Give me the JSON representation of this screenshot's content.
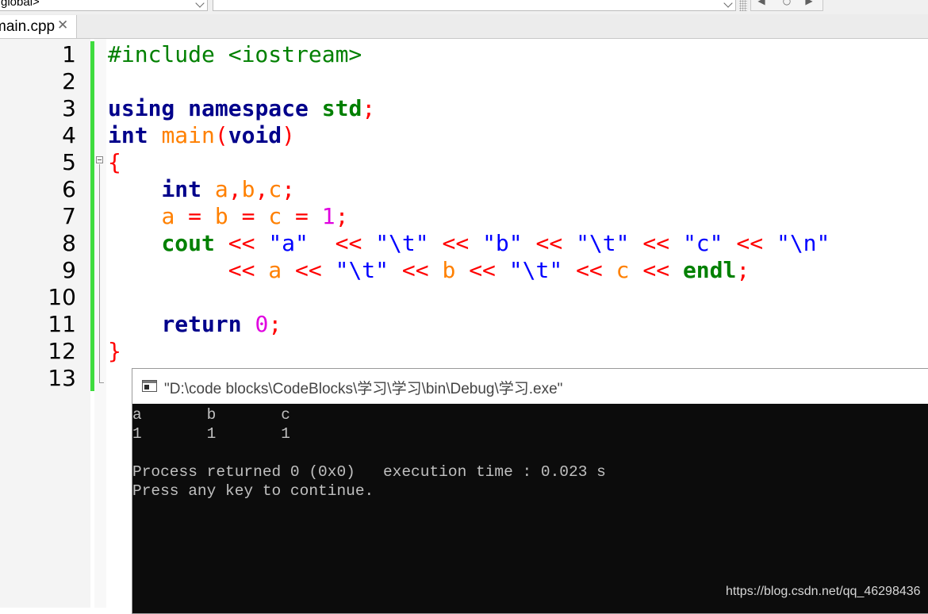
{
  "toolbar": {
    "scope_combo": "global>",
    "symbol_combo": "",
    "buttons": [
      "bookmark-prev-icon",
      "stop-icon",
      "bookmark-next-icon"
    ]
  },
  "tabs": [
    {
      "label": "main.cpp",
      "close_icon": "close-icon"
    }
  ],
  "editor": {
    "line_numbers": [
      "1",
      "2",
      "3",
      "4",
      "5",
      "6",
      "7",
      "8",
      "9",
      "10",
      "11",
      "12",
      "13"
    ],
    "lines": [
      [
        {
          "t": "#include <iostream>",
          "c": "pre"
        }
      ],
      [],
      [
        {
          "t": "using",
          "c": "kw"
        },
        {
          "t": " ",
          "c": "plain"
        },
        {
          "t": "namespace",
          "c": "kw"
        },
        {
          "t": " ",
          "c": "plain"
        },
        {
          "t": "std",
          "c": "kwg"
        },
        {
          "t": ";",
          "c": "op"
        }
      ],
      [
        {
          "t": "int",
          "c": "kw"
        },
        {
          "t": " ",
          "c": "plain"
        },
        {
          "t": "main",
          "c": "id"
        },
        {
          "t": "(",
          "c": "op"
        },
        {
          "t": "void",
          "c": "kw"
        },
        {
          "t": ")",
          "c": "op"
        }
      ],
      [
        {
          "t": "{",
          "c": "op"
        }
      ],
      [
        {
          "t": "    ",
          "c": "plain"
        },
        {
          "t": "int",
          "c": "kw"
        },
        {
          "t": " ",
          "c": "plain"
        },
        {
          "t": "a",
          "c": "id"
        },
        {
          "t": ",",
          "c": "op"
        },
        {
          "t": "b",
          "c": "id"
        },
        {
          "t": ",",
          "c": "op"
        },
        {
          "t": "c",
          "c": "id"
        },
        {
          "t": ";",
          "c": "op"
        }
      ],
      [
        {
          "t": "    ",
          "c": "plain"
        },
        {
          "t": "a",
          "c": "id"
        },
        {
          "t": " ",
          "c": "plain"
        },
        {
          "t": "=",
          "c": "op"
        },
        {
          "t": " ",
          "c": "plain"
        },
        {
          "t": "b",
          "c": "id"
        },
        {
          "t": " ",
          "c": "plain"
        },
        {
          "t": "=",
          "c": "op"
        },
        {
          "t": " ",
          "c": "plain"
        },
        {
          "t": "c",
          "c": "id"
        },
        {
          "t": " ",
          "c": "plain"
        },
        {
          "t": "=",
          "c": "op"
        },
        {
          "t": " ",
          "c": "plain"
        },
        {
          "t": "1",
          "c": "num"
        },
        {
          "t": ";",
          "c": "op"
        }
      ],
      [
        {
          "t": "    ",
          "c": "plain"
        },
        {
          "t": "cout",
          "c": "kwg"
        },
        {
          "t": " ",
          "c": "plain"
        },
        {
          "t": "<<",
          "c": "op"
        },
        {
          "t": " ",
          "c": "plain"
        },
        {
          "t": "\"a\"",
          "c": "str"
        },
        {
          "t": "  ",
          "c": "plain"
        },
        {
          "t": "<<",
          "c": "op"
        },
        {
          "t": " ",
          "c": "plain"
        },
        {
          "t": "\"\\t\"",
          "c": "str"
        },
        {
          "t": " ",
          "c": "plain"
        },
        {
          "t": "<<",
          "c": "op"
        },
        {
          "t": " ",
          "c": "plain"
        },
        {
          "t": "\"b\"",
          "c": "str"
        },
        {
          "t": " ",
          "c": "plain"
        },
        {
          "t": "<<",
          "c": "op"
        },
        {
          "t": " ",
          "c": "plain"
        },
        {
          "t": "\"\\t\"",
          "c": "str"
        },
        {
          "t": " ",
          "c": "plain"
        },
        {
          "t": "<<",
          "c": "op"
        },
        {
          "t": " ",
          "c": "plain"
        },
        {
          "t": "\"c\"",
          "c": "str"
        },
        {
          "t": " ",
          "c": "plain"
        },
        {
          "t": "<<",
          "c": "op"
        },
        {
          "t": " ",
          "c": "plain"
        },
        {
          "t": "\"\\n\"",
          "c": "str"
        }
      ],
      [
        {
          "t": "         ",
          "c": "plain"
        },
        {
          "t": "<<",
          "c": "op"
        },
        {
          "t": " ",
          "c": "plain"
        },
        {
          "t": "a",
          "c": "id"
        },
        {
          "t": " ",
          "c": "plain"
        },
        {
          "t": "<<",
          "c": "op"
        },
        {
          "t": " ",
          "c": "plain"
        },
        {
          "t": "\"\\t\"",
          "c": "str"
        },
        {
          "t": " ",
          "c": "plain"
        },
        {
          "t": "<<",
          "c": "op"
        },
        {
          "t": " ",
          "c": "plain"
        },
        {
          "t": "b",
          "c": "id"
        },
        {
          "t": " ",
          "c": "plain"
        },
        {
          "t": "<<",
          "c": "op"
        },
        {
          "t": " ",
          "c": "plain"
        },
        {
          "t": "\"\\t\"",
          "c": "str"
        },
        {
          "t": " ",
          "c": "plain"
        },
        {
          "t": "<<",
          "c": "op"
        },
        {
          "t": " ",
          "c": "plain"
        },
        {
          "t": "c",
          "c": "id"
        },
        {
          "t": " ",
          "c": "plain"
        },
        {
          "t": "<<",
          "c": "op"
        },
        {
          "t": " ",
          "c": "plain"
        },
        {
          "t": "endl",
          "c": "kwg"
        },
        {
          "t": ";",
          "c": "op"
        }
      ],
      [],
      [
        {
          "t": "    ",
          "c": "plain"
        },
        {
          "t": "return",
          "c": "kw"
        },
        {
          "t": " ",
          "c": "plain"
        },
        {
          "t": "0",
          "c": "num"
        },
        {
          "t": ";",
          "c": "op"
        }
      ],
      [
        {
          "t": "}",
          "c": "op"
        }
      ],
      []
    ]
  },
  "console": {
    "title": "\"D:\\code blocks\\CodeBlocks\\学习\\学习\\bin\\Debug\\学习.exe\"",
    "output_lines": [
      "a       b       c",
      "1       1       1",
      "",
      "Process returned 0 (0x0)   execution time : 0.023 s",
      "Press any key to continue."
    ]
  },
  "watermark": "https://blog.csdn.net/qq_46298436",
  "colors": {
    "keyword": "#00008b",
    "std_keyword": "#008000",
    "identifier": "#ff8000",
    "operator": "#ff0000",
    "number": "#e000e0",
    "string": "#0000ff",
    "change_bar": "#3fdc3f",
    "console_bg": "#0c0c0c",
    "console_text": "#c0c0c0"
  }
}
